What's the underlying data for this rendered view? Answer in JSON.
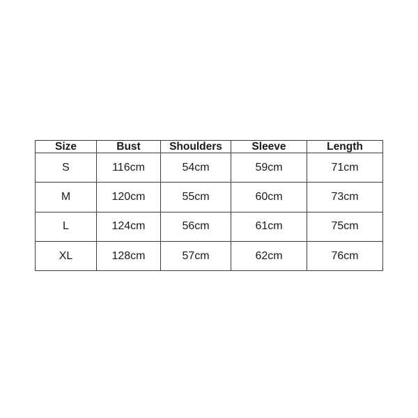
{
  "chart_data": {
    "type": "table",
    "title": "",
    "columns": [
      "Size",
      "Bust",
      "Shoulders",
      "Sleeve",
      "Length"
    ],
    "rows": [
      [
        "S",
        "116cm",
        "54cm",
        "59cm",
        "71cm"
      ],
      [
        "M",
        "120cm",
        "55cm",
        "60cm",
        "73cm"
      ],
      [
        "L",
        "124cm",
        "56cm",
        "61cm",
        "75cm"
      ],
      [
        "XL",
        "128cm",
        "57cm",
        "62cm",
        "76cm"
      ]
    ],
    "units": "cm",
    "measurements": {
      "bust": [
        116,
        120,
        124,
        128
      ],
      "shoulders": [
        54,
        55,
        56,
        57
      ],
      "sleeve": [
        59,
        60,
        61,
        62
      ],
      "length": [
        71,
        73,
        75,
        76
      ]
    },
    "sizes": [
      "S",
      "M",
      "L",
      "XL"
    ],
    "colors": {
      "background": "#ffffff",
      "border": "#3a3a3a",
      "text": "#1a1a1a"
    }
  },
  "table": {
    "header": {
      "size": "Size",
      "bust": "Bust",
      "shoulders": "Shoulders",
      "sleeve": "Sleeve",
      "length": "Length"
    },
    "rows": [
      {
        "size": "S",
        "bust": "116cm",
        "shoulders": "54cm",
        "sleeve": "59cm",
        "length": "71cm"
      },
      {
        "size": "M",
        "bust": "120cm",
        "shoulders": "55cm",
        "sleeve": "60cm",
        "length": "73cm"
      },
      {
        "size": "L",
        "bust": "124cm",
        "shoulders": "56cm",
        "sleeve": "61cm",
        "length": "75cm"
      },
      {
        "size": "XL",
        "bust": "128cm",
        "shoulders": "57cm",
        "sleeve": "62cm",
        "length": "76cm"
      }
    ]
  }
}
